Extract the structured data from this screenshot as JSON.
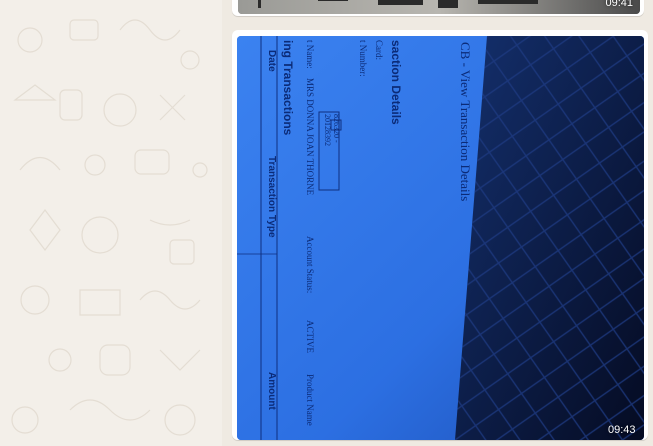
{
  "messages": [
    {
      "type": "image",
      "timestamp": "09:41"
    },
    {
      "type": "image",
      "timestamp": "09:43"
    }
  ],
  "photo_text": {
    "title": "CB - View Transaction Details",
    "section_heading": "saction Details",
    "card_label": "Card:",
    "number_label": "t Number:",
    "number_value_1": "826320 -",
    "number_value_2": "20128392",
    "name_label": "t Name:",
    "name_value": "MRS DONNA JOAN THORNE",
    "account_status_label": "Account Status:",
    "account_status_value": "ACTIVE",
    "product_label": "Product Name",
    "transactions_heading": "ing Transactions",
    "col_date": "Date",
    "col_type": "Transaction Type",
    "col_amount": "Amount"
  },
  "colors": {
    "screen_blue": "#2e72e6",
    "dark_building": "#0a1840",
    "chat_bg": "#efeae2"
  }
}
